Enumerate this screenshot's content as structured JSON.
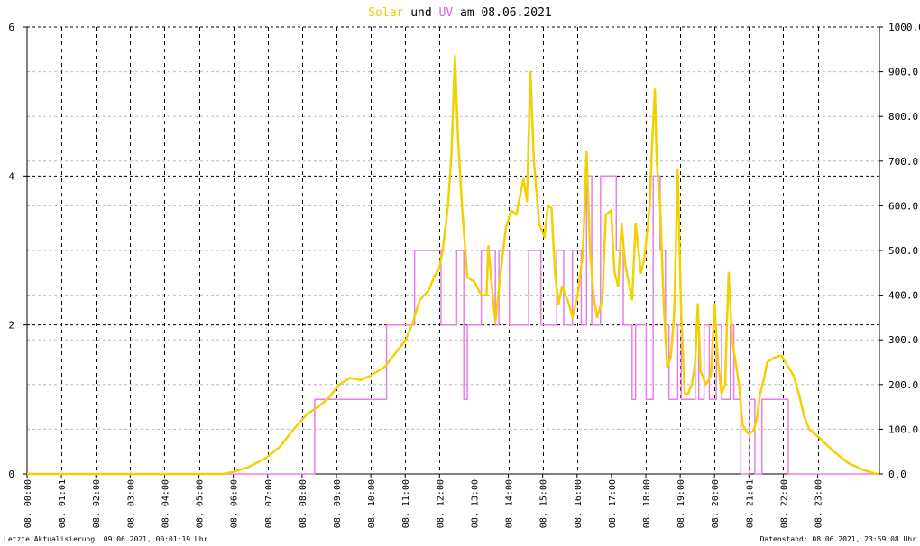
{
  "title": {
    "part1": "Solar",
    "part2": " und ",
    "part3": "UV",
    "part4": " am 08.06.2021"
  },
  "footer": {
    "left": "Letzte Aktualisierung: 09.06.2021, 00:01:19 Uhr",
    "right": "Datenstand: 08.06.2021, 23:59:08 Uhr"
  },
  "colors": {
    "solar": "#f5d000",
    "uv": "#e87ee8",
    "solar_title": "#f0c800",
    "uv_title": "#e060e0"
  },
  "chart_data": {
    "type": "line",
    "x_unit": "hours of day",
    "xlim": [
      0,
      24.3
    ],
    "y_left": {
      "ylim": [
        0,
        6
      ],
      "ticks": [
        0,
        2,
        4,
        6
      ],
      "tick_labels": [
        "0",
        "2",
        "4",
        "6"
      ]
    },
    "y_right": {
      "ylim": [
        0,
        1000
      ],
      "ticks": [
        0,
        100,
        200,
        300,
        400,
        500,
        600,
        700,
        800,
        900,
        1000
      ],
      "tick_labels": [
        "0.0",
        "100.0",
        "200.0",
        "300.0",
        "400.0",
        "500.0",
        "600.0",
        "700.0",
        "800.0",
        "900.0",
        "1000.0"
      ]
    },
    "x_ticks": [
      {
        "x": 0.0,
        "label": "08. 00:00"
      },
      {
        "x": 0.98,
        "label": "08. 01:01"
      },
      {
        "x": 1.96,
        "label": "08. 02:00"
      },
      {
        "x": 2.94,
        "label": "08. 03:00"
      },
      {
        "x": 3.92,
        "label": "08. 04:00"
      },
      {
        "x": 4.9,
        "label": "08. 05:00"
      },
      {
        "x": 5.88,
        "label": "08. 06:00"
      },
      {
        "x": 6.86,
        "label": "08. 07:00"
      },
      {
        "x": 7.84,
        "label": "08. 08:00"
      },
      {
        "x": 8.82,
        "label": "08. 09:00"
      },
      {
        "x": 9.8,
        "label": "08. 10:00"
      },
      {
        "x": 10.78,
        "label": "08. 11:00"
      },
      {
        "x": 11.76,
        "label": "08. 12:00"
      },
      {
        "x": 12.74,
        "label": "08. 13:00"
      },
      {
        "x": 13.72,
        "label": "08. 14:00"
      },
      {
        "x": 14.7,
        "label": "08. 15:00"
      },
      {
        "x": 15.68,
        "label": "08. 16:00"
      },
      {
        "x": 16.66,
        "label": "08. 17:00"
      },
      {
        "x": 17.64,
        "label": "08. 18:00"
      },
      {
        "x": 18.62,
        "label": "08. 19:00"
      },
      {
        "x": 19.6,
        "label": "08. 20:00"
      },
      {
        "x": 20.58,
        "label": "08. 21:01"
      },
      {
        "x": 21.56,
        "label": "08. 22:00"
      },
      {
        "x": 22.54,
        "label": "08. 23:00"
      }
    ],
    "series": [
      {
        "name": "Solar",
        "axis": "right",
        "points": [
          [
            0,
            0
          ],
          [
            5.6,
            0
          ],
          [
            5.9,
            5
          ],
          [
            6.3,
            15
          ],
          [
            6.8,
            35
          ],
          [
            7.2,
            60
          ],
          [
            7.6,
            100
          ],
          [
            8.0,
            135
          ],
          [
            8.3,
            150
          ],
          [
            8.6,
            170
          ],
          [
            8.9,
            200
          ],
          [
            9.2,
            215
          ],
          [
            9.5,
            210
          ],
          [
            9.8,
            220
          ],
          [
            10.2,
            240
          ],
          [
            10.5,
            270
          ],
          [
            10.8,
            300
          ],
          [
            11.0,
            340
          ],
          [
            11.2,
            390
          ],
          [
            11.45,
            410
          ],
          [
            11.6,
            440
          ],
          [
            11.75,
            460
          ],
          [
            11.85,
            500
          ],
          [
            12.0,
            600
          ],
          [
            12.1,
            720
          ],
          [
            12.2,
            935
          ],
          [
            12.28,
            760
          ],
          [
            12.4,
            600
          ],
          [
            12.55,
            440
          ],
          [
            12.75,
            430
          ],
          [
            12.95,
            400
          ],
          [
            13.1,
            400
          ],
          [
            13.15,
            510
          ],
          [
            13.25,
            420
          ],
          [
            13.35,
            340
          ],
          [
            13.5,
            450
          ],
          [
            13.65,
            550
          ],
          [
            13.8,
            590
          ],
          [
            13.95,
            580
          ],
          [
            14.15,
            660
          ],
          [
            14.25,
            610
          ],
          [
            14.35,
            900
          ],
          [
            14.45,
            700
          ],
          [
            14.6,
            560
          ],
          [
            14.75,
            530
          ],
          [
            14.85,
            600
          ],
          [
            14.95,
            595
          ],
          [
            15.05,
            450
          ],
          [
            15.15,
            380
          ],
          [
            15.25,
            420
          ],
          [
            15.45,
            380
          ],
          [
            15.55,
            350
          ],
          [
            15.7,
            400
          ],
          [
            15.85,
            500
          ],
          [
            15.95,
            720
          ],
          [
            16.05,
            500
          ],
          [
            16.15,
            400
          ],
          [
            16.25,
            350
          ],
          [
            16.4,
            390
          ],
          [
            16.5,
            580
          ],
          [
            16.65,
            590
          ],
          [
            16.75,
            450
          ],
          [
            16.85,
            420
          ],
          [
            16.95,
            560
          ],
          [
            17.05,
            470
          ],
          [
            17.15,
            430
          ],
          [
            17.25,
            390
          ],
          [
            17.35,
            560
          ],
          [
            17.5,
            450
          ],
          [
            17.6,
            480
          ],
          [
            17.75,
            600
          ],
          [
            17.82,
            740
          ],
          [
            17.9,
            860
          ],
          [
            17.95,
            700
          ],
          [
            18.05,
            600
          ],
          [
            18.15,
            380
          ],
          [
            18.25,
            240
          ],
          [
            18.35,
            260
          ],
          [
            18.45,
            360
          ],
          [
            18.55,
            680
          ],
          [
            18.65,
            350
          ],
          [
            18.75,
            180
          ],
          [
            18.85,
            180
          ],
          [
            18.95,
            200
          ],
          [
            19.05,
            250
          ],
          [
            19.12,
            380
          ],
          [
            19.2,
            230
          ],
          [
            19.35,
            200
          ],
          [
            19.5,
            220
          ],
          [
            19.6,
            380
          ],
          [
            19.7,
            250
          ],
          [
            19.8,
            180
          ],
          [
            19.9,
            200
          ],
          [
            20.0,
            450
          ],
          [
            20.1,
            300
          ],
          [
            20.2,
            250
          ],
          [
            20.3,
            200
          ],
          [
            20.4,
            110
          ],
          [
            20.55,
            90
          ],
          [
            20.7,
            95
          ],
          [
            20.8,
            120
          ],
          [
            20.9,
            180
          ],
          [
            21.0,
            210
          ],
          [
            21.1,
            250
          ],
          [
            21.3,
            260
          ],
          [
            21.5,
            265
          ],
          [
            21.7,
            240
          ],
          [
            21.85,
            220
          ],
          [
            22.0,
            180
          ],
          [
            22.15,
            130
          ],
          [
            22.3,
            100
          ],
          [
            22.6,
            80
          ],
          [
            23.0,
            50
          ],
          [
            23.4,
            25
          ],
          [
            23.8,
            10
          ],
          [
            24.2,
            0
          ],
          [
            24.3,
            0
          ]
        ]
      },
      {
        "name": "UV",
        "axis": "left",
        "points": [
          [
            0,
            0
          ],
          [
            8.2,
            0
          ],
          [
            8.2,
            1
          ],
          [
            10.25,
            1
          ],
          [
            10.25,
            2
          ],
          [
            11.05,
            2
          ],
          [
            11.05,
            3
          ],
          [
            11.8,
            3
          ],
          [
            11.8,
            2
          ],
          [
            12.25,
            2
          ],
          [
            12.25,
            3
          ],
          [
            12.45,
            3
          ],
          [
            12.45,
            1
          ],
          [
            12.55,
            1
          ],
          [
            12.55,
            2
          ],
          [
            12.95,
            2
          ],
          [
            12.95,
            3
          ],
          [
            13.35,
            3
          ],
          [
            13.35,
            2
          ],
          [
            13.45,
            2
          ],
          [
            13.45,
            3
          ],
          [
            13.75,
            3
          ],
          [
            13.75,
            2
          ],
          [
            14.3,
            2
          ],
          [
            14.3,
            3
          ],
          [
            14.65,
            3
          ],
          [
            14.65,
            2
          ],
          [
            15.1,
            2
          ],
          [
            15.1,
            3
          ],
          [
            15.3,
            3
          ],
          [
            15.3,
            2
          ],
          [
            15.55,
            2
          ],
          [
            15.55,
            3
          ],
          [
            15.8,
            3
          ],
          [
            15.8,
            2
          ],
          [
            15.95,
            2
          ],
          [
            15.95,
            4
          ],
          [
            16.1,
            4
          ],
          [
            16.1,
            2
          ],
          [
            16.35,
            2
          ],
          [
            16.35,
            4
          ],
          [
            16.8,
            4
          ],
          [
            16.8,
            3
          ],
          [
            17.0,
            3
          ],
          [
            17.0,
            2
          ],
          [
            17.25,
            2
          ],
          [
            17.25,
            1
          ],
          [
            17.35,
            1
          ],
          [
            17.35,
            2
          ],
          [
            17.65,
            2
          ],
          [
            17.65,
            1
          ],
          [
            17.85,
            1
          ],
          [
            17.85,
            4
          ],
          [
            18.05,
            4
          ],
          [
            18.05,
            3
          ],
          [
            18.2,
            3
          ],
          [
            18.2,
            2
          ],
          [
            18.3,
            2
          ],
          [
            18.3,
            1
          ],
          [
            18.55,
            1
          ],
          [
            18.55,
            2
          ],
          [
            18.65,
            2
          ],
          [
            18.65,
            1
          ],
          [
            19.05,
            1
          ],
          [
            19.05,
            2
          ],
          [
            19.15,
            2
          ],
          [
            19.15,
            1
          ],
          [
            19.3,
            1
          ],
          [
            19.3,
            2
          ],
          [
            19.45,
            2
          ],
          [
            19.45,
            1
          ],
          [
            19.65,
            1
          ],
          [
            19.65,
            2
          ],
          [
            19.8,
            2
          ],
          [
            19.8,
            1
          ],
          [
            20.05,
            1
          ],
          [
            20.05,
            2
          ],
          [
            20.15,
            2
          ],
          [
            20.15,
            1
          ],
          [
            20.35,
            1
          ],
          [
            20.35,
            0
          ],
          [
            20.6,
            0
          ],
          [
            20.6,
            1
          ],
          [
            20.75,
            1
          ],
          [
            20.75,
            0
          ],
          [
            20.95,
            0
          ],
          [
            20.95,
            1
          ],
          [
            21.7,
            1
          ],
          [
            21.7,
            0
          ],
          [
            24.3,
            0
          ]
        ]
      }
    ]
  }
}
